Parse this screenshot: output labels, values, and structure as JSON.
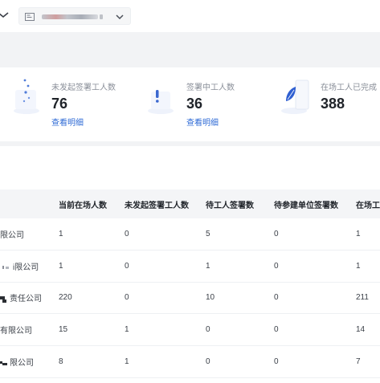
{
  "topbar": {
    "project_select": {
      "selected_value": "",
      "fold_icon": "folder-icon",
      "chevron_icon": "chevron-down-icon"
    },
    "left_chevron_icon": "chevron-down-icon"
  },
  "stats": [
    {
      "label": "未发起签署工人数",
      "value": "76",
      "link": "查看明细",
      "icon": "dots-icon",
      "accent": "#4f7bd8"
    },
    {
      "label": "签署中工人数",
      "value": "36",
      "link": "查看明细",
      "icon": "exclamation-icon",
      "accent": "#3a67cf"
    },
    {
      "label": "在场工人已完成",
      "value": "388",
      "link": "",
      "icon": "leaf-icon",
      "accent": "#2f5fd1"
    }
  ],
  "table": {
    "columns": [
      "",
      "当前在场人数",
      "未发起签署工人数",
      "待工人签署数",
      "待参建单位签署数",
      "在场工"
    ],
    "rows": [
      {
        "company": "限公司",
        "mask": "none",
        "cells": [
          "1",
          "0",
          "5",
          "0",
          "1"
        ]
      },
      {
        "company": "i限公司",
        "mask": "small",
        "cells": [
          "1",
          "0",
          "1",
          "0",
          "1"
        ]
      },
      {
        "company": "责任公司",
        "mask": "dark",
        "cells": [
          "220",
          "0",
          "10",
          "0",
          "211"
        ]
      },
      {
        "company": "有限公司",
        "mask": "none",
        "cells": [
          "15",
          "1",
          "0",
          "0",
          "14"
        ]
      },
      {
        "company": "限公司",
        "mask": "dark2",
        "cells": [
          "8",
          "1",
          "0",
          "0",
          "7"
        ]
      }
    ]
  },
  "colors": {
    "link": "#2f6bd6",
    "band": "#f2f3f5",
    "header_bg": "#f4f5f7"
  }
}
